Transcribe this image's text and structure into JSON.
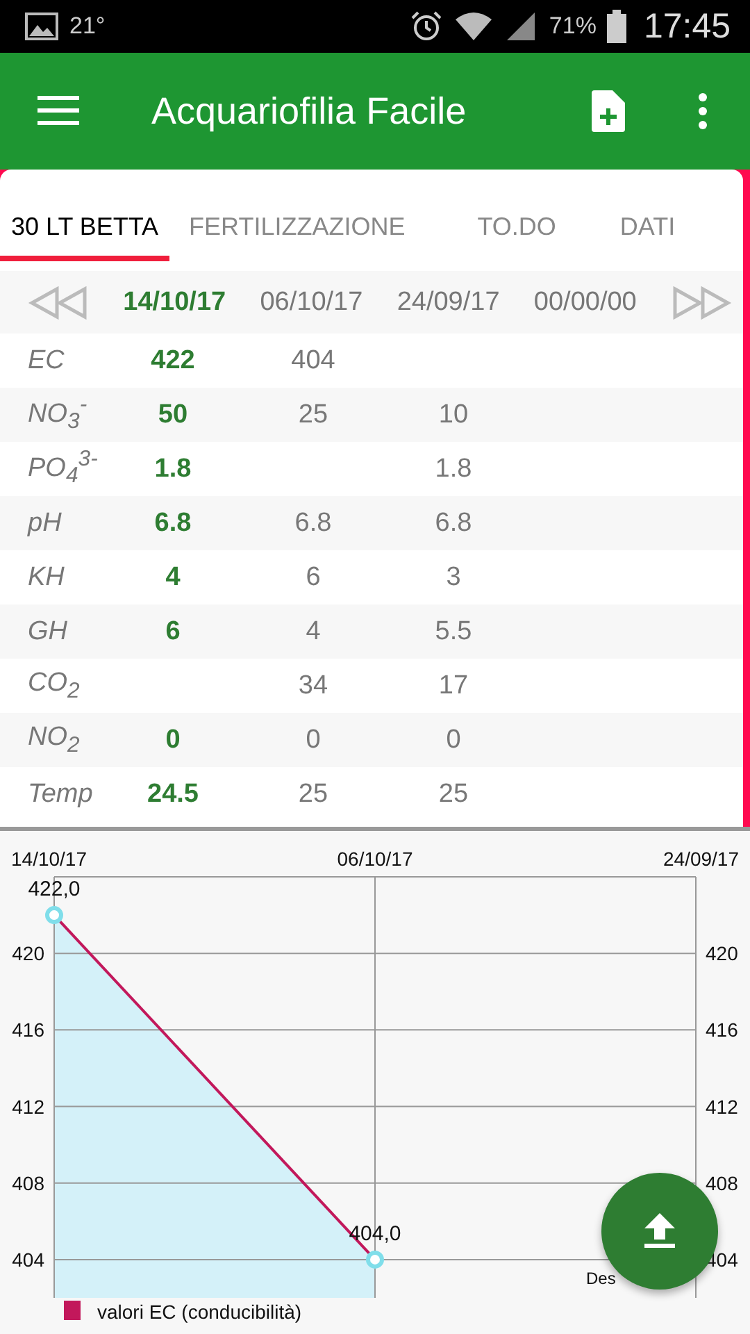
{
  "status_bar": {
    "temperature": "21°",
    "battery": "71%",
    "time": "17:45"
  },
  "app_bar": {
    "title": "Acquariofilia Facile"
  },
  "tabs": [
    {
      "label": "30 LT BETTA",
      "selected": true
    },
    {
      "label": "FERTILIZZAZIONE",
      "selected": false
    },
    {
      "label": "TO.DO",
      "selected": false
    },
    {
      "label": "DATI",
      "selected": false
    }
  ],
  "dates": [
    {
      "label": "14/10/17",
      "selected": true
    },
    {
      "label": "06/10/17",
      "selected": false
    },
    {
      "label": "24/09/17",
      "selected": false
    },
    {
      "label": "00/00/00",
      "selected": false
    }
  ],
  "rows": [
    {
      "label": "EC",
      "values": {
        "column_1": "422",
        "column_2": "404"
      }
    },
    {
      "label": "NO$_{3}$$^{-}$",
      "values": {
        "column_1": "50",
        "column_2": "25",
        "column_3": "10"
      }
    },
    {
      "label": "PO$_{4}$$^{3-}$",
      "values": {
        "column_1": "1.8",
        "column_3": "1.8"
      }
    },
    {
      "label": "pH",
      "values": {
        "column_1": "6.8",
        "column_2": "6.8",
        "column_3": "6.8"
      }
    },
    {
      "label": "KH",
      "values": {
        "column_1": "4",
        "column_2": "6",
        "column_3": "3"
      }
    },
    {
      "label": "GH",
      "values": {
        "column_1": "6",
        "column_2": "4",
        "column_3": "5.5"
      }
    },
    {
      "label": "CO$_{2}$",
      "values": {
        "column_2": "34",
        "column_3": "17"
      }
    },
    {
      "label": "NO$_{2}$",
      "values": {
        "column_1": "0",
        "column_2": "0",
        "column_3": "0"
      }
    },
    {
      "label": "Temp",
      "values": {
        "column_1": "24.5",
        "column_2": "25",
        "column_3": "25"
      }
    }
  ],
  "chart": {
    "description_text": "Des",
    "right_axis_ticks": [
      "420",
      "416",
      "412",
      "408",
      "404"
    ],
    "chart_data": {
      "type": "area",
      "grid": true,
      "categories": [
        "14/10/17",
        "06/10/17",
        "24/09/17"
      ],
      "series": [
        {
          "name": "valori EC (conducibilità)",
          "color": "#c2185b",
          "values": [
            422,
            404,
            null
          ]
        }
      ],
      "ylim": [
        402,
        424
      ],
      "yticks": [
        404,
        408,
        412,
        416,
        420
      ],
      "value_labels": [
        "422,0",
        "404,0"
      ]
    }
  }
}
